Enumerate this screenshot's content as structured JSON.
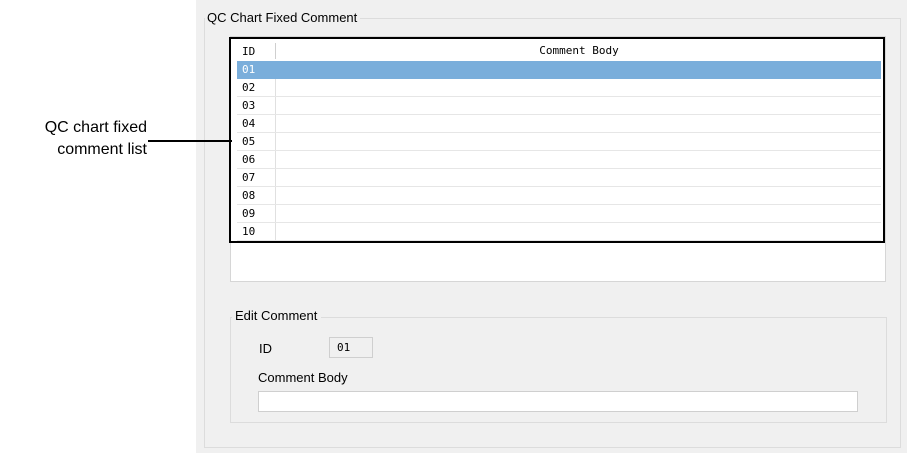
{
  "group": {
    "title": "QC Chart Fixed Comment"
  },
  "list": {
    "header": {
      "id": "ID",
      "body": "Comment Body"
    },
    "selected_index": 0,
    "rows": [
      {
        "id": "01",
        "body": ""
      },
      {
        "id": "02",
        "body": ""
      },
      {
        "id": "03",
        "body": ""
      },
      {
        "id": "04",
        "body": ""
      },
      {
        "id": "05",
        "body": ""
      },
      {
        "id": "06",
        "body": ""
      },
      {
        "id": "07",
        "body": ""
      },
      {
        "id": "08",
        "body": ""
      },
      {
        "id": "09",
        "body": ""
      },
      {
        "id": "10",
        "body": ""
      }
    ]
  },
  "callout": {
    "line1": "QC chart fixed",
    "line2": "comment list"
  },
  "edit": {
    "title": "Edit Comment",
    "id_label": "ID",
    "id_value": "01",
    "body_label": "Comment Body",
    "body_value": ""
  },
  "colors": {
    "selection": "#7aaedb",
    "panel": "#f0f0f0",
    "highlight_frame": "#000000"
  }
}
